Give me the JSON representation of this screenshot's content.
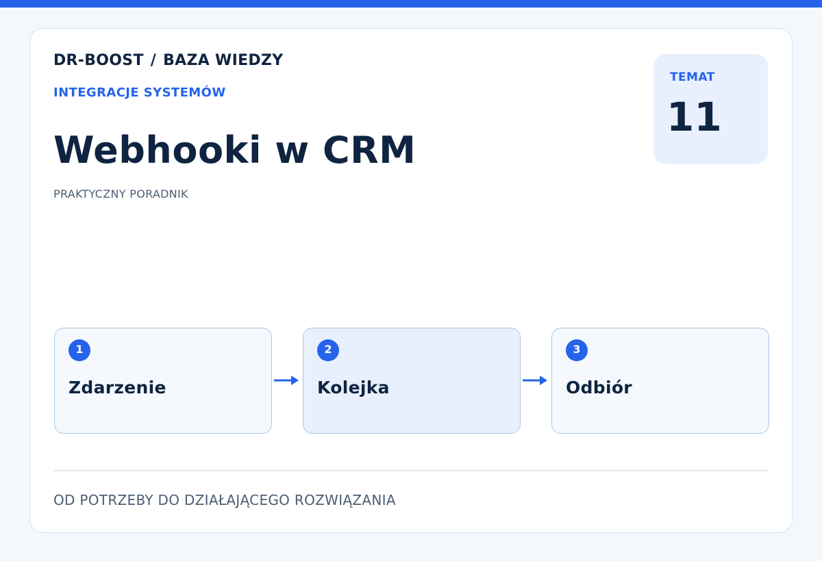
{
  "header": {
    "brand": "DR-BOOST",
    "separator": "/",
    "section": "BAZA WIEDZY",
    "category": "INTEGRACJE SYSTEMÓW"
  },
  "title": "Webhooki w CRM",
  "subtitle": "PRAKTYCZNY PORADNIK",
  "topic": {
    "label": "TEMAT",
    "number": "11"
  },
  "steps": [
    {
      "number": "1",
      "label": "Zdarzenie"
    },
    {
      "number": "2",
      "label": "Kolejka"
    },
    {
      "number": "3",
      "label": "Odbiór"
    }
  ],
  "footer": "OD POTRZEBY DO DZIAŁAJĄCEGO ROZWIĄZANIA",
  "colors": {
    "accent": "#2563eb",
    "heading": "#0f2440",
    "muted": "#4b5e73",
    "badge_bg": "#e8f0fe"
  }
}
